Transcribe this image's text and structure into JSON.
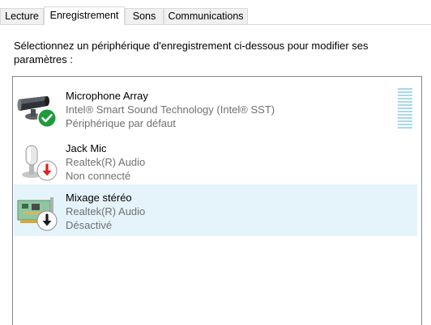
{
  "tabs": [
    {
      "label": "Lecture",
      "active": false
    },
    {
      "label": "Enregistrement",
      "active": true
    },
    {
      "label": "Sons",
      "active": false
    },
    {
      "label": "Communications",
      "active": false
    }
  ],
  "instructions": "Sélectionnez un périphérique d'enregistrement ci-dessous pour modifier ses paramètres :",
  "devices": [
    {
      "name": "Microphone Array",
      "driver": "Intel® Smart Sound Technology (Intel® SST)",
      "status": "Périphérique par défaut",
      "icon": "microphone-array-icon",
      "badge": "default-check-badge-icon"
    },
    {
      "name": "Jack Mic",
      "driver": "Realtek(R) Audio",
      "status": "Non connecté",
      "icon": "microphone-icon",
      "badge": "unplugged-arrow-badge-icon"
    },
    {
      "name": "Mixage stéréo",
      "driver": "Realtek(R) Audio",
      "status": "Désactivé",
      "icon": "sound-card-icon",
      "badge": "disabled-arrow-badge-icon"
    }
  ],
  "colors": {
    "selection": "#e5f3fb",
    "badge_green": "#1e9b3b",
    "badge_red": "#e02020",
    "secondary_text": "#707070",
    "level_meter": "#a8d8e8"
  }
}
